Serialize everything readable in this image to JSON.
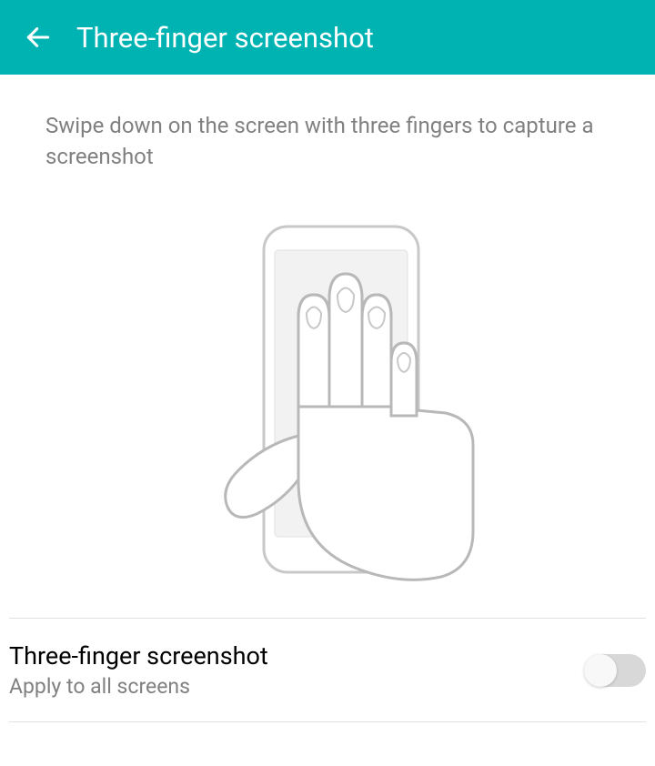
{
  "header": {
    "title": "Three-finger screenshot"
  },
  "instruction": "Swipe down on the screen with three fingers to capture a screenshot",
  "setting": {
    "title": "Three-finger screenshot",
    "subtitle": "Apply to all screens",
    "enabled": false
  }
}
